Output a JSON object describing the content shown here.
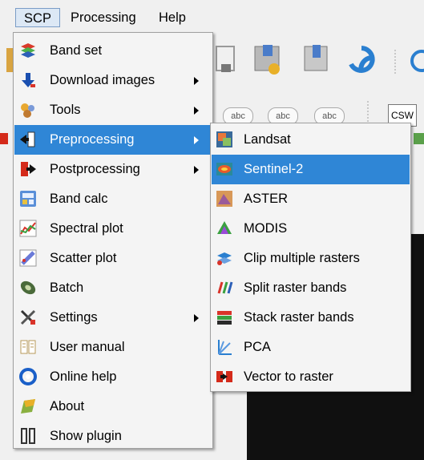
{
  "menubar": {
    "items": [
      {
        "label": "SCP"
      },
      {
        "label": "Processing"
      },
      {
        "label": "Help"
      }
    ]
  },
  "toolbar": {
    "csw_label": "CSW",
    "abc_label": "abc"
  },
  "scp_menu": {
    "items": [
      {
        "label": "Band set",
        "icon": "band-set-icon",
        "submenu": false
      },
      {
        "label": "Download images",
        "icon": "download-arrow-icon",
        "submenu": true
      },
      {
        "label": "Tools",
        "icon": "tools-icon",
        "submenu": true
      },
      {
        "label": "Preprocessing",
        "icon": "preprocessing-icon",
        "submenu": true,
        "highlighted": true
      },
      {
        "label": "Postprocessing",
        "icon": "postprocessing-icon",
        "submenu": true
      },
      {
        "label": "Band calc",
        "icon": "band-calc-icon",
        "submenu": false
      },
      {
        "label": "Spectral plot",
        "icon": "spectral-plot-icon",
        "submenu": false
      },
      {
        "label": "Scatter plot",
        "icon": "scatter-plot-icon",
        "submenu": false
      },
      {
        "label": "Batch",
        "icon": "batch-icon",
        "submenu": false
      },
      {
        "label": "Settings",
        "icon": "settings-icon",
        "submenu": true
      },
      {
        "label": "User manual",
        "icon": "user-manual-icon",
        "submenu": false
      },
      {
        "label": "Online help",
        "icon": "online-help-icon",
        "submenu": false
      },
      {
        "label": "About",
        "icon": "about-icon",
        "submenu": false
      },
      {
        "label": "Show plugin",
        "icon": "show-plugin-icon",
        "submenu": false
      }
    ]
  },
  "preprocessing_menu": {
    "items": [
      {
        "label": "Landsat",
        "icon": "landsat-icon"
      },
      {
        "label": "Sentinel-2",
        "icon": "sentinel2-icon",
        "highlighted": true
      },
      {
        "label": "ASTER",
        "icon": "aster-icon"
      },
      {
        "label": "MODIS",
        "icon": "modis-icon"
      },
      {
        "label": "Clip multiple rasters",
        "icon": "clip-rasters-icon"
      },
      {
        "label": "Split raster bands",
        "icon": "split-bands-icon"
      },
      {
        "label": "Stack raster bands",
        "icon": "stack-bands-icon"
      },
      {
        "label": "PCA",
        "icon": "pca-icon"
      },
      {
        "label": "Vector to raster",
        "icon": "vector-to-raster-icon"
      }
    ]
  },
  "colors": {
    "highlight": "#2f86d6",
    "menu_bg": "#f4f4f4",
    "canvas": "#101010"
  }
}
